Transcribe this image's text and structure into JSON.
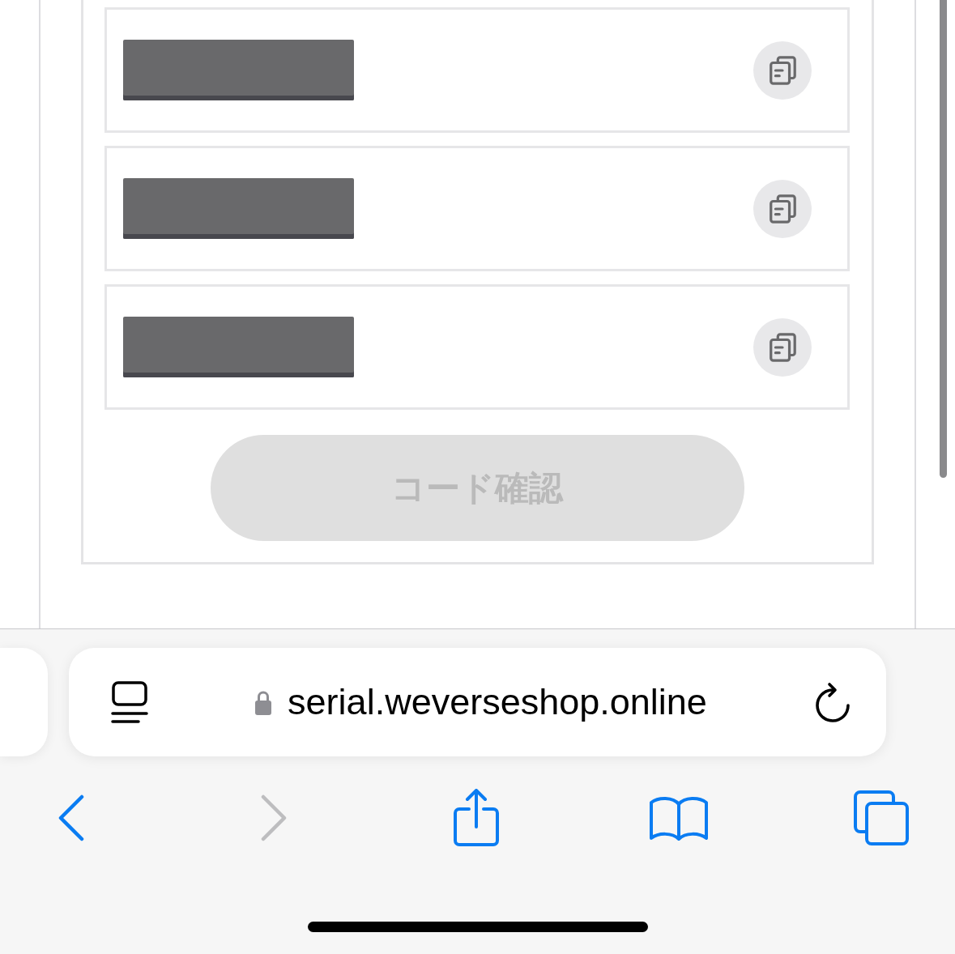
{
  "codes": [
    {
      "kind": "redacted"
    },
    {
      "kind": "redacted"
    },
    {
      "kind": "redacted"
    }
  ],
  "confirm_button": {
    "label": "コード確認",
    "disabled": true
  },
  "browser": {
    "url": "serial.weverseshop.online",
    "secure": true
  },
  "toolbar": [
    {
      "kind": "back",
      "disabled": false
    },
    {
      "kind": "forward",
      "disabled": true
    },
    {
      "kind": "share",
      "disabled": false
    },
    {
      "kind": "bookmarks",
      "disabled": false
    },
    {
      "kind": "tabs",
      "disabled": false
    }
  ]
}
